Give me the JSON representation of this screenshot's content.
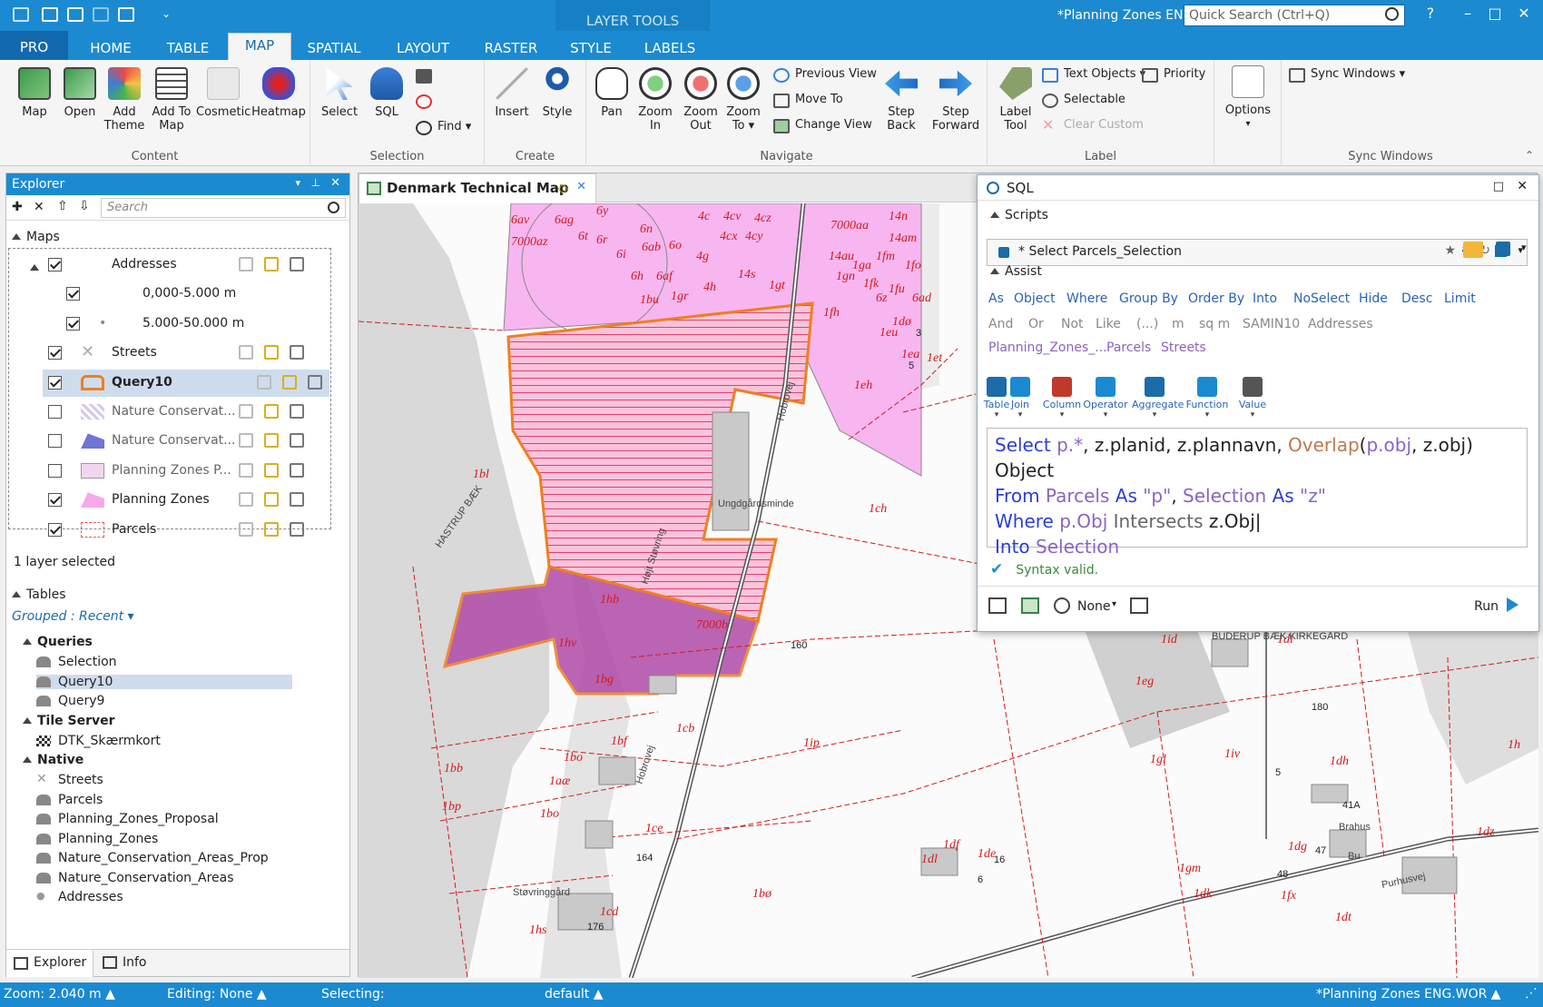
{
  "window": {
    "title": "*Planning Zones ENG",
    "layer_tools": "LAYER TOOLS",
    "quick_search_placeholder": "Quick Search (Ctrl+Q)",
    "controls": [
      "?",
      "–",
      "□",
      "✕"
    ]
  },
  "tabs": [
    "PRO",
    "HOME",
    "TABLE",
    "MAP",
    "SPATIAL",
    "LAYOUT",
    "RASTER",
    "STYLE",
    "LABELS"
  ],
  "active_tab": "MAP",
  "ribbon": {
    "groups": {
      "content": "Content",
      "selection": "Selection",
      "create": "Create",
      "navigate": "Navigate",
      "label": "Label",
      "sync": "Sync Windows"
    },
    "content_buttons": [
      "Map",
      "Open",
      "Add Theme",
      "Add To Map",
      "Cosmetic",
      "Heatmap"
    ],
    "selection_buttons": [
      "Select",
      "SQL",
      "Find"
    ],
    "create_buttons": [
      "Insert",
      "Style"
    ],
    "navigate_buttons": [
      "Pan",
      "Zoom In",
      "Zoom Out",
      "Zoom To"
    ],
    "navigate_small": [
      "Previous View",
      "Move To",
      "Change View"
    ],
    "step_buttons": [
      "Step Back",
      "Step Forward"
    ],
    "label_tool": "Label Tool",
    "label_small": [
      "Text Objects",
      "Priority",
      "Selectable",
      "Clear Custom"
    ],
    "options": "Options",
    "sync_windows": "Sync Windows"
  },
  "explorer": {
    "title": "Explorer",
    "search_placeholder": "Search",
    "maps_header": "Maps",
    "layers": [
      {
        "name": "Addresses",
        "checked": true
      },
      {
        "name": "0,000-5.000 m",
        "checked": true
      },
      {
        "name": "5.000-50.000 m",
        "checked": true
      },
      {
        "name": "Streets",
        "checked": true
      },
      {
        "name": "Query10",
        "checked": true
      },
      {
        "name": "Nature Conservat...",
        "checked": false
      },
      {
        "name": "Nature Conservat...",
        "checked": false
      },
      {
        "name": "Planning Zones P...",
        "checked": false
      },
      {
        "name": "Planning Zones",
        "checked": true
      },
      {
        "name": "Parcels",
        "checked": true
      }
    ],
    "selected_status": "1 layer selected",
    "tables_header": "Tables",
    "grouped": "Grouped : Recent",
    "groups": [
      {
        "name": "Queries",
        "items": [
          "Selection",
          "Query10",
          "Query9"
        ]
      },
      {
        "name": "Tile Server",
        "items": [
          "DTK_Skærmkort"
        ]
      },
      {
        "name": "Native",
        "items": [
          "Streets",
          "Parcels",
          "Planning_Zones_Proposal",
          "Planning_Zones",
          "Nature_Conservation_Areas_Prop",
          "Nature_Conservation_Areas",
          "Addresses"
        ]
      }
    ],
    "bottom_tabs": [
      "Explorer",
      "Info"
    ]
  },
  "map": {
    "tab_title": "Denmark Technical Map",
    "labels": [
      "6av",
      "6ag",
      "6y",
      "4c",
      "4cv",
      "4cz",
      "7000aa",
      "14n",
      "7000az",
      "6t",
      "6r",
      "6n",
      "6ab",
      "6o",
      "4cx",
      "4cy",
      "14am",
      "6i",
      "4g",
      "14au",
      "1ga",
      "1fm",
      "1fo",
      "6h",
      "6af",
      "4h",
      "14s",
      "1gn",
      "1fk",
      "1fu",
      "6z",
      "6ad",
      "1bu",
      "1gr",
      "1gt",
      "1fh",
      "1dø",
      "1eu",
      "3",
      "1ea",
      "5",
      "1eh",
      "1et",
      "1bl",
      "1ch",
      "1hb",
      "7000b",
      "1hv",
      "1bg",
      "1ie",
      "1gø",
      "1id",
      "1di",
      "1eg",
      "1cb",
      "1bf",
      "1ip",
      "1gl",
      "1iv",
      "1dh",
      "1h",
      "1bo",
      "1bb",
      "1aæ",
      "1bp",
      "1ce",
      "1bo",
      "1dl",
      "1df",
      "1de",
      "1dg",
      "1gm",
      "1dk",
      "1fx",
      "1dt",
      "1dz",
      "1bø",
      "1cd",
      "1hs",
      "160",
      "164",
      "176",
      "180",
      "41A",
      "47",
      "48",
      "16",
      "6",
      "5"
    ],
    "place_names": [
      "Ungdgårdsminde",
      "Støvringgård",
      "Hobrovej",
      "Hobrovej",
      "HASTRUP BÆK",
      "Højt Støvring",
      "Purhusvej",
      "BUDERUP BÆK KIRKEGÅRD",
      "Brahus",
      "Bu"
    ]
  },
  "sql": {
    "title": "SQL",
    "scripts_header": "Scripts",
    "script_name": "* Select Parcels_Selection",
    "assist_header": "Assist",
    "assist_row1": [
      "As",
      "Object",
      "Where",
      "Group By",
      "Order By",
      "Into",
      "NoSelect",
      "Hide",
      "Desc",
      "Limit"
    ],
    "assist_row2": [
      "And",
      "Or",
      "Not",
      "Like",
      "(...)",
      "m",
      "sq m",
      "SAMIN10",
      "Addresses"
    ],
    "assist_row3": [
      "Planning_Zones_...",
      "Parcels",
      "Streets"
    ],
    "assist_buttons": [
      "Table",
      "Join",
      "Column",
      "Operator",
      "Aggregate",
      "Function",
      "Value"
    ],
    "query": {
      "line1": {
        "kw": "Select",
        "a": "p.*",
        "b": ", z.planid, z.plannavn, ",
        "fn": "Overlap",
        "c": "(",
        "d": "p.obj",
        ",e": ", z.obj) Object"
      },
      "l1_kw": "Select",
      "l1_a": "p.*",
      "l1_b": ", z.planid, z.plannavn, ",
      "l1_fn": "Overlap",
      "l1_c": "(",
      "l1_d": "p.obj",
      "l1_e": ", z.obj) Object",
      "l2_kw": "From",
      "l2_a": "Parcels",
      "l2_b": "As",
      "l2_c": "\"p\"",
      "l2_d": ", ",
      "l2_e": "Selection",
      "l2_f": "As",
      "l2_g": "\"z\"",
      "l3_kw": "Where",
      "l3_a": "p.Obj",
      "l3_b": "Intersects",
      "l3_c": "z.Obj",
      "l4_kw": "Into",
      "l4_a": "Selection"
    },
    "syntax_status": "Syntax valid.",
    "none_label": "None",
    "run_label": "Run"
  },
  "status": {
    "zoom": "Zoom: 2.040 m",
    "editing": "Editing: None",
    "selecting": "Selecting:",
    "default": "default",
    "workspace": "*Planning Zones ENG.WOR"
  },
  "colors": {
    "accent": "#1b8ad1",
    "selection_fill": "#f5a8c9",
    "zone_fill": "#f7b6f0",
    "query_fill": "#b04aa8",
    "selection_stroke": "#f07f1e"
  }
}
